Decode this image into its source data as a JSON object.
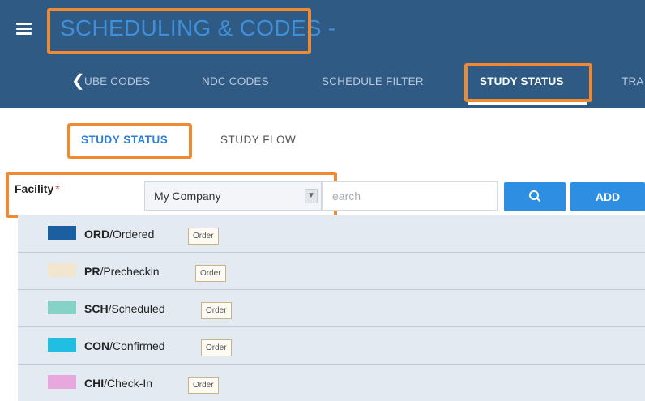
{
  "header": {
    "title": "SCHEDULING & CODES -",
    "tabs": [
      {
        "label": "UBE CODES"
      },
      {
        "label": "NDC CODES"
      },
      {
        "label": "SCHEDULE FILTER"
      },
      {
        "label": "STUDY STATUS",
        "active": true
      },
      {
        "label": "TRA"
      }
    ]
  },
  "subtabs": [
    {
      "label": "STUDY STATUS",
      "active": true
    },
    {
      "label": "STUDY FLOW"
    }
  ],
  "filter": {
    "facility_label": "Facility",
    "required_mark": "*",
    "facility_value": "My Company",
    "search_placeholder": "earch",
    "add_label": "ADD"
  },
  "statuses": [
    {
      "code": "ORD",
      "name": "/Ordered",
      "color": "#1b5fa0",
      "order_label": "Order"
    },
    {
      "code": "PR",
      "name": "/Precheckin",
      "color": "#f2e6cf",
      "order_label": "Order"
    },
    {
      "code": "SCH",
      "name": "/Scheduled",
      "color": "#86d1c8",
      "order_label": "Order"
    },
    {
      "code": "CON",
      "name": "/Confirmed",
      "color": "#22bde2",
      "order_label": "Order"
    },
    {
      "code": "CHI",
      "name": "/Check-In",
      "color": "#e8a8dd",
      "order_label": "Order"
    }
  ],
  "colors": {
    "header_bg": "#2e5a84",
    "accent": "#2e8fe2",
    "highlight": "#f08a32"
  }
}
